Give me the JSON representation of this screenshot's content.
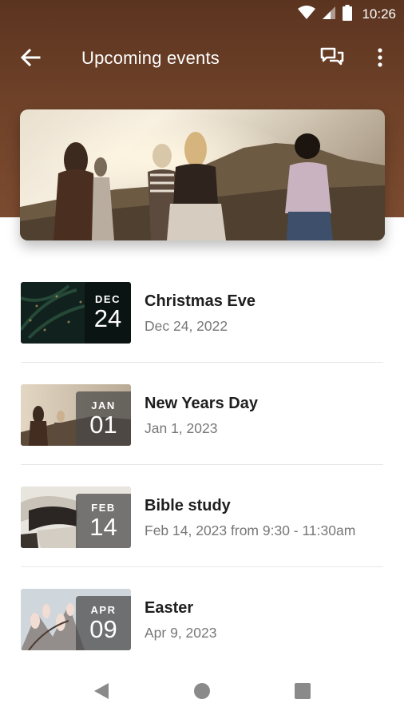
{
  "status_bar": {
    "time": "10:26"
  },
  "app_bar": {
    "title": "Upcoming events"
  },
  "events": [
    {
      "month": "DEC",
      "day": "24",
      "title": "Christmas Eve",
      "subtitle": "Dec 24, 2022"
    },
    {
      "month": "JAN",
      "day": "01",
      "title": "New Years Day",
      "subtitle": "Jan 1, 2023"
    },
    {
      "month": "FEB",
      "day": "14",
      "title": "Bible study",
      "subtitle": "Feb 14, 2023 from 9:30 - 11:30am"
    },
    {
      "month": "APR",
      "day": "09",
      "title": "Easter",
      "subtitle": "Apr 9, 2023"
    }
  ],
  "colors": {
    "header": "#6e4128",
    "text_primary": "#1e1e1e",
    "text_secondary": "#777777"
  },
  "icons": [
    "wifi-icon",
    "signal-icon",
    "battery-icon",
    "back-arrow-icon",
    "chat-icon",
    "more-vert-icon",
    "nav-back-icon",
    "nav-home-icon",
    "nav-recents-icon"
  ]
}
